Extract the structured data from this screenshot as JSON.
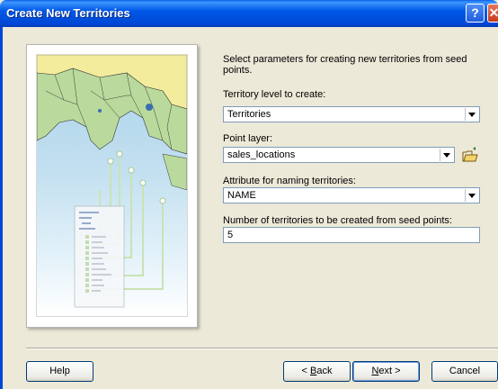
{
  "window": {
    "title": "Create New Territories"
  },
  "intro": "Select parameters for creating new territories from seed points.",
  "fields": {
    "territory_level": {
      "label": "Territory level to create:",
      "value": "Territories"
    },
    "point_layer": {
      "label": "Point layer:",
      "value": "sales_locations"
    },
    "attribute": {
      "label": "Attribute for naming territories:",
      "value": "NAME"
    },
    "count": {
      "label": "Number of territories to be created from seed points:",
      "value": "5"
    }
  },
  "buttons": {
    "help": "Help",
    "back_accel": "B",
    "back_rest": "ack",
    "back_prefix": "< ",
    "next_accel": "N",
    "next_rest": "ext >",
    "cancel": "Cancel"
  },
  "colors": {
    "titlebar": "#0058e6",
    "dialog_bg": "#ece9d8",
    "field_border": "#7f9db9"
  },
  "icons": [
    "help-icon",
    "close-icon",
    "open-folder-icon",
    "map-illustration"
  ]
}
